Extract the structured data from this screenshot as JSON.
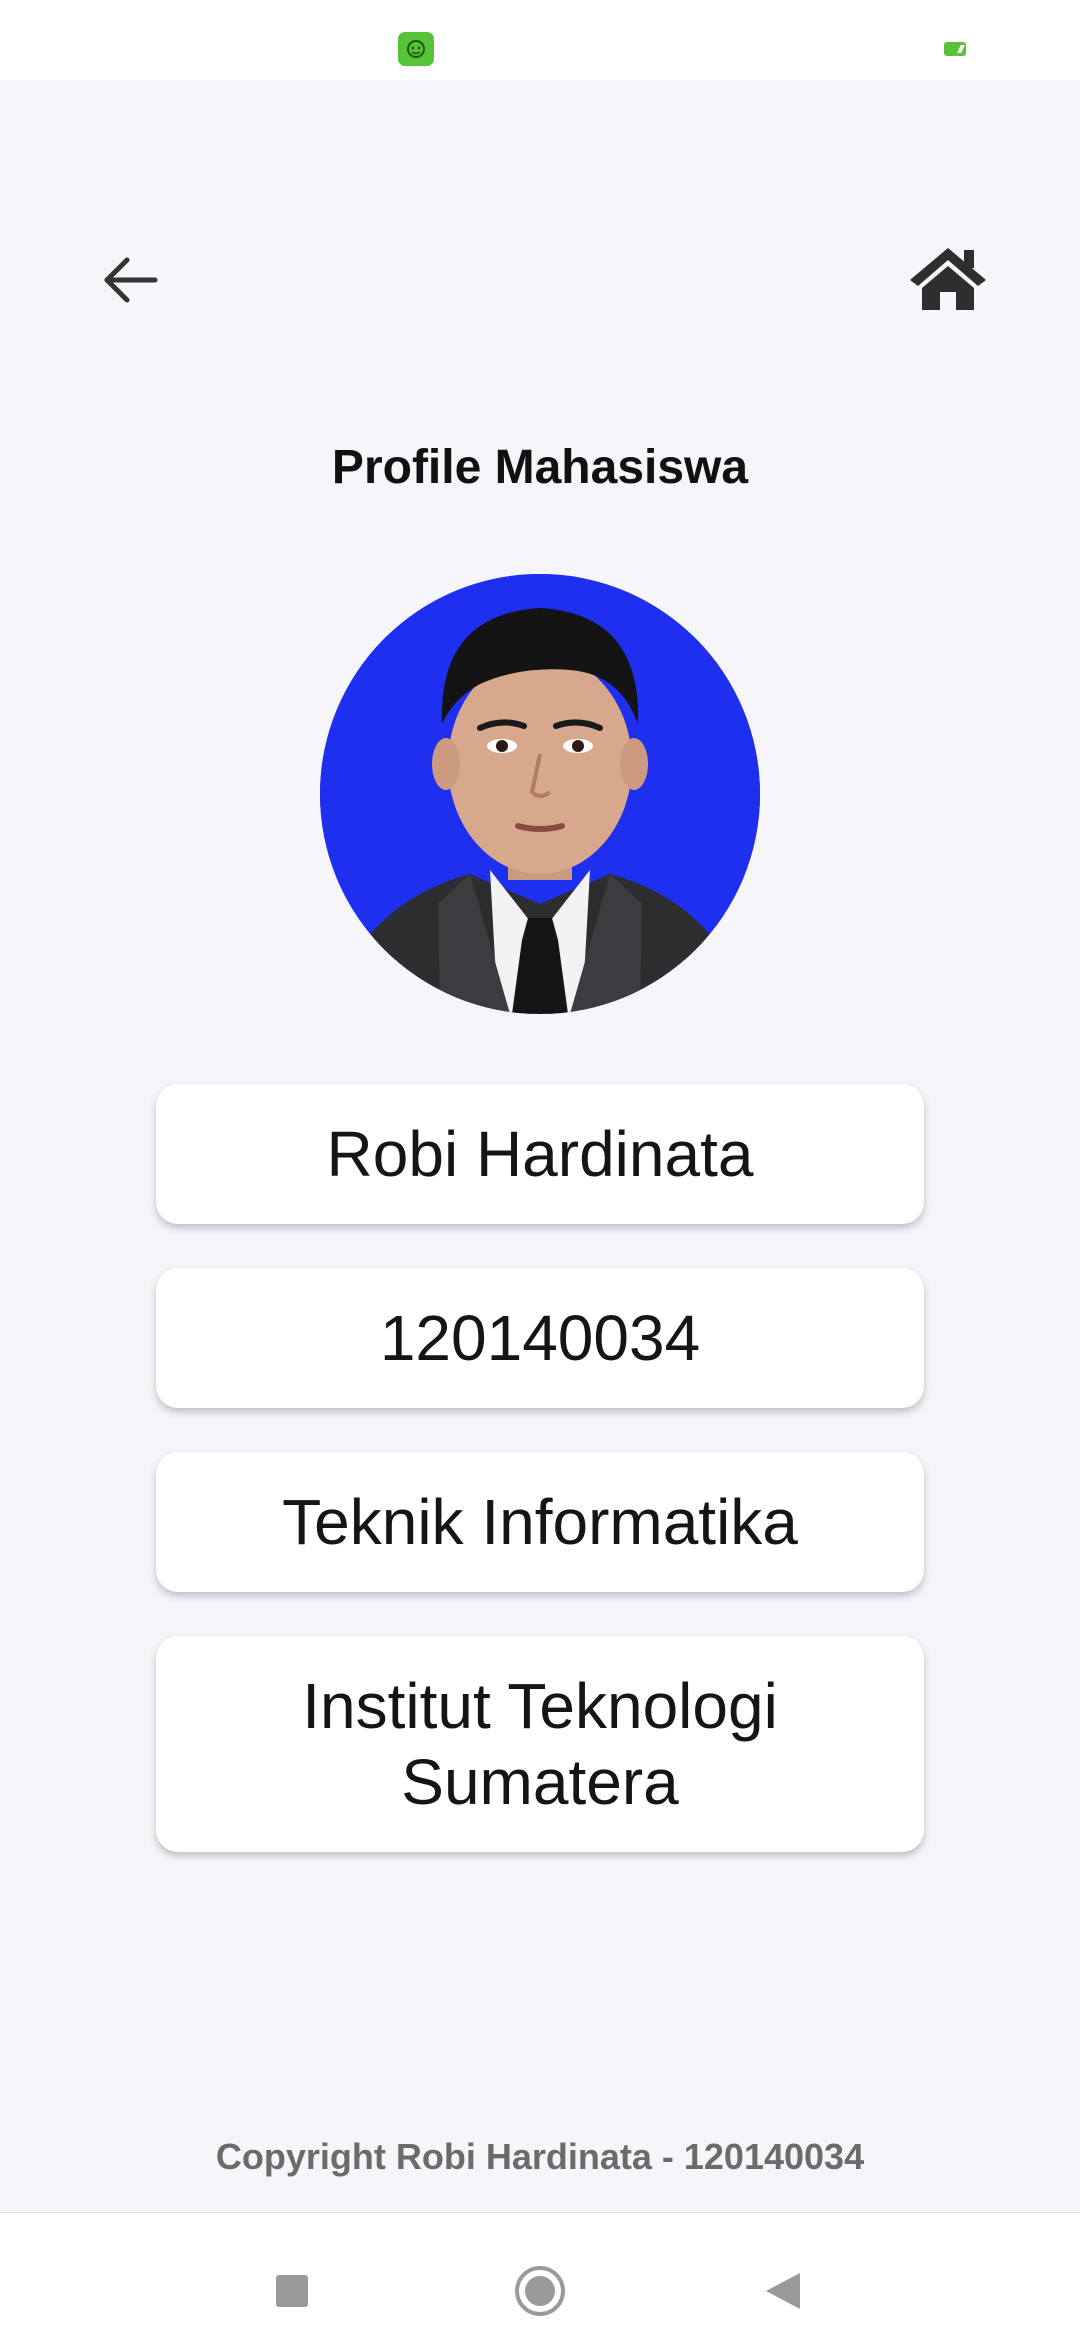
{
  "page": {
    "title": "Profile Mahasiswa",
    "background_color": "#f5f5fa"
  },
  "icons": {
    "back": "arrow-left-icon",
    "home": "home-icon",
    "status_app": "app-notification-icon",
    "battery": "battery-icon"
  },
  "profile": {
    "name": "Robi Hardinata",
    "nim": "120140034",
    "study_program": "Teknik Informatika",
    "institution": "Institut Teknologi Sumatera",
    "avatar_background_color": "#1f2ff0"
  },
  "footer": {
    "copyright": "Copyright Robi Hardinata - 120140034"
  },
  "system_nav": {
    "recents": "square-recents-icon",
    "home": "circle-home-icon",
    "back": "triangle-back-icon"
  }
}
